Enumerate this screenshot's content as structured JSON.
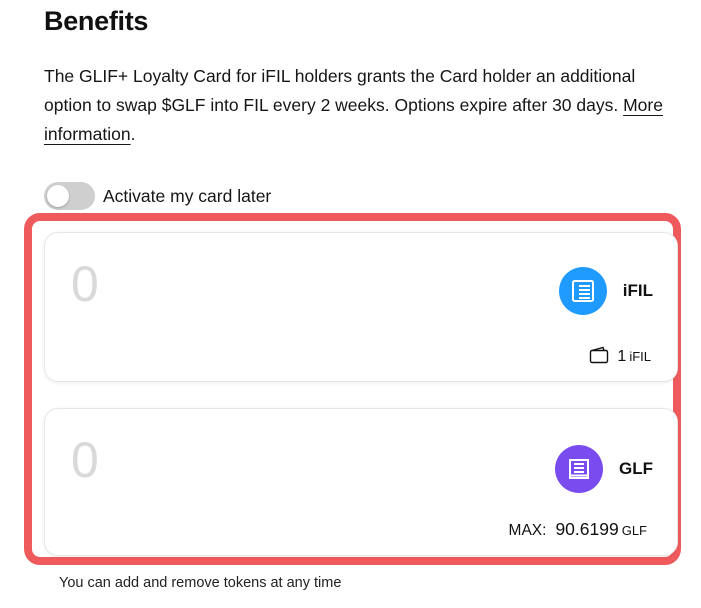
{
  "section": {
    "title": "Benefits",
    "description": "The GLIF+ Loyalty Card for iFIL holders grants the Card holder an additional option to swap $GLF into FIL every 2 weeks. Options expire after 30 days.",
    "more_link": "More information",
    "period": "."
  },
  "toggle": {
    "label": "Activate my card later",
    "checked": false
  },
  "cards": [
    {
      "amount_placeholder": "0",
      "token": "iFIL",
      "token_color": "#1f9bff",
      "balance_value": "1",
      "balance_unit": "iFIL"
    },
    {
      "amount_placeholder": "0",
      "token": "GLF",
      "token_color": "#7a4cf0",
      "max_label": "MAX:",
      "max_value": "90.6199",
      "max_unit": "GLF"
    }
  ],
  "highlight_color": "#ef5a5d",
  "footnote": "You can add and remove tokens at any time"
}
